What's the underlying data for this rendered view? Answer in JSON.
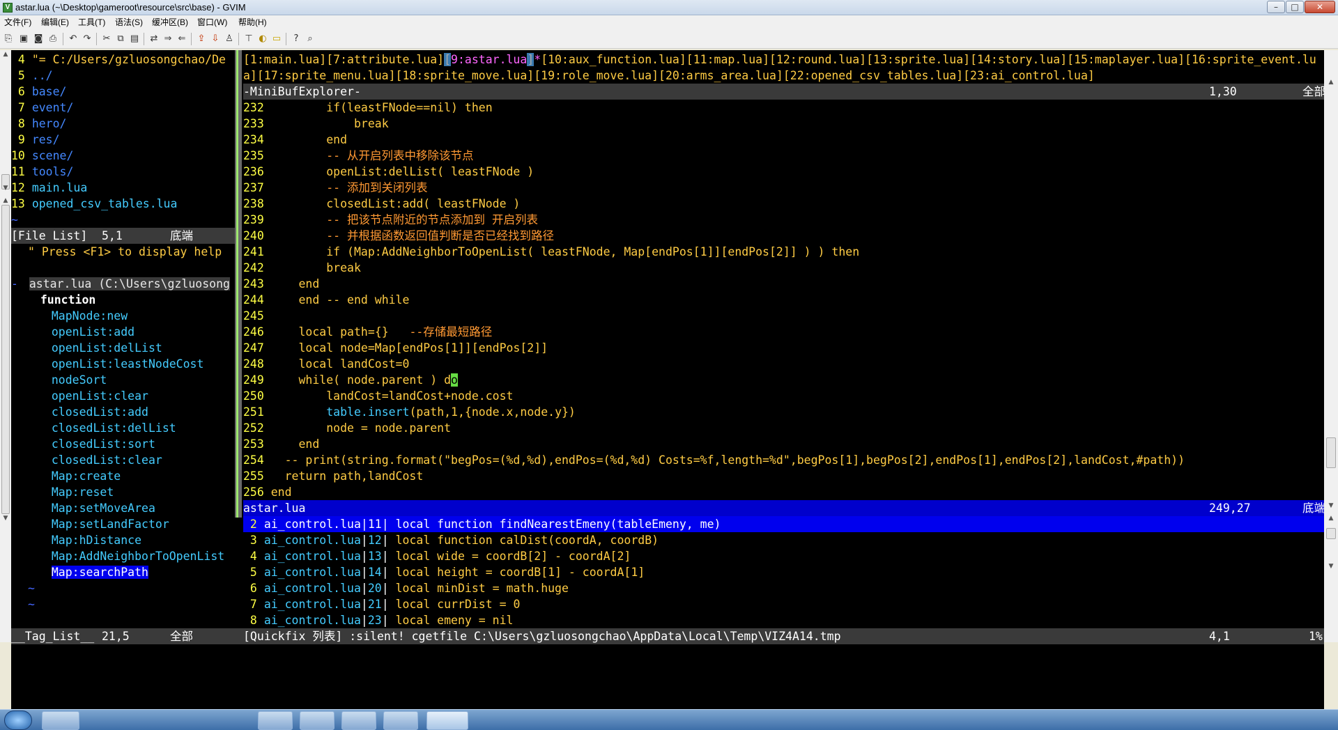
{
  "window": {
    "title": "astar.lua (~\\Desktop\\gameroot\\resource\\src\\base) - GVIM",
    "buttons": {
      "minimize": "–",
      "maximize": "□",
      "close": "✕"
    }
  },
  "menu": [
    "文件(F)",
    "编辑(E)",
    "工具(T)",
    "语法(S)",
    "缓冲区(B)",
    "窗口(W)",
    "帮助(H)"
  ],
  "toolbar": {
    "icons": [
      "open-icon",
      "save-icon",
      "save-all-icon",
      "print-icon",
      "undo-icon",
      "redo-icon",
      "cut-icon",
      "copy-icon",
      "paste-icon",
      "replace-icon",
      "find-next-icon",
      "find-prev-icon",
      "load-session-icon",
      "save-session-icon",
      "run-script-icon",
      "make-icon",
      "build-tags-icon",
      "jump-tag-icon",
      "help-icon",
      "find-help-icon"
    ]
  },
  "file_list": {
    "lines": [
      {
        "num": " 4",
        "text": "\"= C:/Users/gzluosongchao/De",
        "kind": "cmt"
      },
      {
        "num": " 5",
        "text": "../",
        "kind": "dir"
      },
      {
        "num": " 6",
        "text": "base/",
        "kind": "dir"
      },
      {
        "num": " 7",
        "text": "event/",
        "kind": "dir"
      },
      {
        "num": " 8",
        "text": "hero/",
        "kind": "dir"
      },
      {
        "num": " 9",
        "text": "res/",
        "kind": "dir"
      },
      {
        "num": "10",
        "text": "scene/",
        "kind": "dir"
      },
      {
        "num": "11",
        "text": "tools/",
        "kind": "dir"
      },
      {
        "num": "12",
        "text": "main.lua",
        "kind": "file"
      },
      {
        "num": "13",
        "text": "opened_csv_tables.lua",
        "kind": "file"
      }
    ],
    "tilde": "~",
    "status": {
      "name": "[File List]",
      "pos": "5,1",
      "where": "底端"
    }
  },
  "tag_list": {
    "help": "\" Press <F1> to display help",
    "file_line": "astar.lua (C:\\Users\\gzluosong",
    "group": "function",
    "tags": [
      "MapNode:new",
      "openList:add",
      "openList:delList",
      "openList:leastNodeCost",
      "nodeSort",
      "openList:clear",
      "closedList:add",
      "closedList:delList",
      "closedList:sort",
      "closedList:clear",
      "Map:create",
      "Map:reset",
      "Map:setMoveArea",
      "Map:setLandFactor",
      "Map:hDistance",
      "Map:AddNeighborToOpenList",
      "Map:searchPath"
    ],
    "selected": "Map:searchPath",
    "tilde": "~",
    "status": {
      "name": "__Tag_List__",
      "pos": "21,5",
      "where": "全部"
    }
  },
  "minibuf": {
    "line1_segs": [
      {
        "t": "[1:main.lua][7:attribute.lua]",
        "c": "#ffcc44",
        "b": ""
      },
      {
        "t": "[",
        "c": "#aaaaaa",
        "b": "#3a7ab0"
      },
      {
        "t": "9:astar.lua",
        "c": "#ff66ff",
        "b": ""
      },
      {
        "t": "]",
        "c": "#aaaaaa",
        "b": "#3a7ab0"
      },
      {
        "t": "*",
        "c": "#ff66ff",
        "b": ""
      },
      {
        "t": "[10:aux_function.lua][11:map.lua][12:round.lua][13:sprite.lua][14:story.lua][15:maplayer.lua][16:sprite_event.lu",
        "c": "#ffcc44",
        "b": ""
      }
    ],
    "line2": "a][17:sprite_menu.lua][18:sprite_move.lua][19:role_move.lua][20:arms_area.lua][22:opened_csv_tables.lua][23:ai_control.lua]",
    "status": {
      "name": "-MiniBufExplorer-",
      "pos": "1,30",
      "where": "全部"
    }
  },
  "code": {
    "lines": [
      {
        "num": "232",
        "segs": [
          {
            "t": "        if(leastFNode==nil) ",
            "c": "#ffcc44"
          },
          {
            "t": "then",
            "c": "#ffcc44"
          }
        ]
      },
      {
        "num": "233",
        "segs": [
          {
            "t": "            break",
            "c": "#ffcc44"
          }
        ]
      },
      {
        "num": "234",
        "segs": [
          {
            "t": "        end",
            "c": "#ffcc44"
          }
        ]
      },
      {
        "num": "235",
        "segs": [
          {
            "t": "        -- 从开启列表中移除该节点",
            "c": "#ff9933"
          }
        ]
      },
      {
        "num": "236",
        "segs": [
          {
            "t": "        openList:delList( leastFNode )",
            "c": "#ffcc44"
          }
        ]
      },
      {
        "num": "237",
        "segs": [
          {
            "t": "        -- 添加到关闭列表",
            "c": "#ff9933"
          }
        ]
      },
      {
        "num": "238",
        "segs": [
          {
            "t": "        closedList:add( leastFNode )",
            "c": "#ffcc44"
          }
        ]
      },
      {
        "num": "239",
        "segs": [
          {
            "t": "        -- 把该节点附近的节点添加到 开启列表",
            "c": "#ff9933"
          }
        ]
      },
      {
        "num": "240",
        "segs": [
          {
            "t": "        -- 并根据函数返回值判断是否已经找到路径",
            "c": "#ff9933"
          }
        ]
      },
      {
        "num": "241",
        "segs": [
          {
            "t": "        if (Map:AddNeighborToOpenList( leastFNode, Map[endPos[1]][endPos[2]] ) ) then",
            "c": "#ffcc44"
          }
        ]
      },
      {
        "num": "242",
        "segs": [
          {
            "t": "        break",
            "c": "#ffcc44"
          }
        ]
      },
      {
        "num": "243",
        "segs": [
          {
            "t": "    end",
            "c": "#ffcc44"
          }
        ]
      },
      {
        "num": "244",
        "segs": [
          {
            "t": "    end -- end while",
            "c": "#ffcc44"
          }
        ]
      },
      {
        "num": "245",
        "segs": [
          {
            "t": "",
            "c": "#ffcc44"
          }
        ]
      },
      {
        "num": "246",
        "segs": [
          {
            "t": "    local path={}   ",
            "c": "#ffcc44"
          },
          {
            "t": "--存储最短路径",
            "c": "#ff9933"
          }
        ]
      },
      {
        "num": "247",
        "segs": [
          {
            "t": "    local node=Map[endPos[1]][endPos[2]]",
            "c": "#ffcc44"
          }
        ]
      },
      {
        "num": "248",
        "segs": [
          {
            "t": "    local landCost=0",
            "c": "#ffcc44"
          }
        ]
      },
      {
        "num": "249",
        "segs": [
          {
            "t": "    while( node.parent ) d",
            "c": "#ffcc44"
          },
          {
            "t": "o",
            "c": "#000000",
            "b": "#66dd44"
          }
        ]
      },
      {
        "num": "250",
        "segs": [
          {
            "t": "        landCost=landCost+node.cost",
            "c": "#ffcc44"
          }
        ]
      },
      {
        "num": "251",
        "segs": [
          {
            "t": "        ",
            "c": "#ffcc44"
          },
          {
            "t": "table.insert",
            "c": "#44ccff"
          },
          {
            "t": "(path,1,{node.x,node.y})",
            "c": "#ffcc44"
          }
        ]
      },
      {
        "num": "252",
        "segs": [
          {
            "t": "        node = node.parent",
            "c": "#ffcc44"
          }
        ]
      },
      {
        "num": "253",
        "segs": [
          {
            "t": "    end",
            "c": "#ffcc44"
          }
        ]
      },
      {
        "num": "254",
        "segs": [
          {
            "t": "  -- print(string.format(\"begPos=(%d,%d),endPos=(%d,%d) Costs=%f,length=%d\",begPos[1],begPos[2],endPos[1],endPos[2],landCost,#path))",
            "c": "#ffcc44"
          }
        ]
      },
      {
        "num": "255",
        "segs": [
          {
            "t": "  return path,landCost",
            "c": "#ffcc44"
          }
        ]
      },
      {
        "num": "256",
        "segs": [
          {
            "t": "end",
            "c": "#ffcc44"
          }
        ]
      }
    ],
    "status": {
      "name": "astar.lua",
      "pos": "249,27",
      "where": "底端"
    }
  },
  "quickfix": {
    "lines": [
      {
        "num": " 2",
        "file": "ai_control.lua",
        "line": "11",
        "text": "local function findNearestEmeny(tableEmeny, me)",
        "selected": true
      },
      {
        "num": " 3",
        "file": "ai_control.lua",
        "line": "12",
        "text": "local function calDist(coordA, coordB)",
        "selected": false
      },
      {
        "num": " 4",
        "file": "ai_control.lua",
        "line": "13",
        "text": "local wide = coordB[2] - coordA[2]",
        "selected": false
      },
      {
        "num": " 5",
        "file": "ai_control.lua",
        "line": "14",
        "text": "local height = coordB[1] - coordA[1]",
        "selected": false
      },
      {
        "num": " 6",
        "file": "ai_control.lua",
        "line": "20",
        "text": "local minDist = math.huge",
        "selected": false
      },
      {
        "num": " 7",
        "file": "ai_control.lua",
        "line": "21",
        "text": "local currDist = 0",
        "selected": false
      },
      {
        "num": " 8",
        "file": "ai_control.lua",
        "line": "23",
        "text": "local emeny = nil",
        "selected": false
      }
    ],
    "status": {
      "name": "[Quickfix 列表] :silent! cgetfile C:\\Users\\gzluosongchao\\AppData\\Local\\Temp\\VIZ4A14.tmp",
      "pos": "4,1",
      "where": "1%"
    }
  },
  "colors": {
    "linenr": "#ffff44",
    "dir": "#4488ff",
    "file": "#44ccff",
    "status_bg": "#3a3a3a",
    "status_cur_bg": "#0000cc",
    "select_bg": "#0000ee"
  }
}
